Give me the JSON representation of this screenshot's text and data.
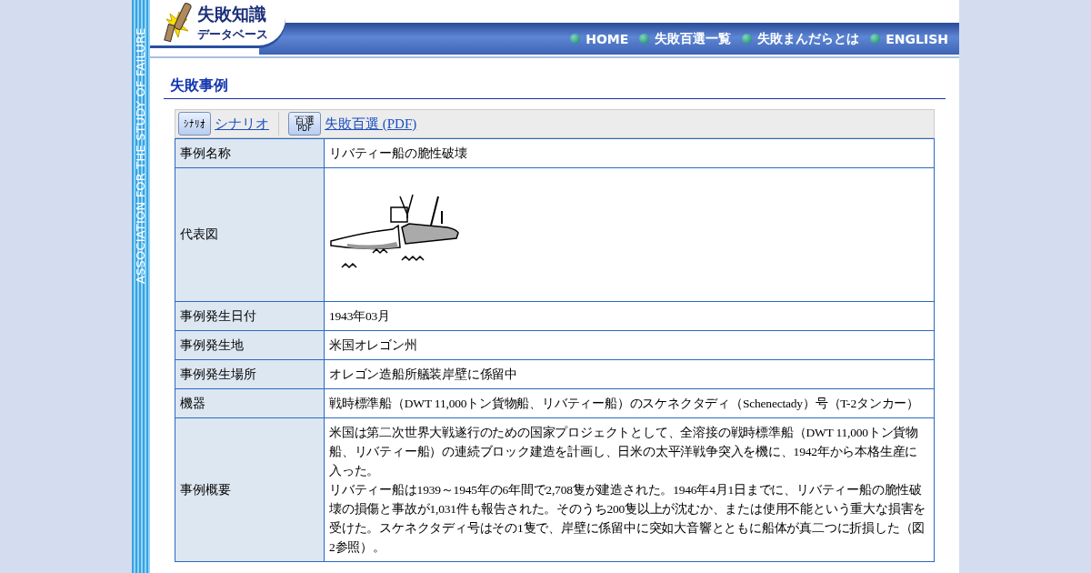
{
  "side_banner": {
    "text": "ASSOCIATION FOR THE STUDY OF FAILURE"
  },
  "logo": {
    "line_1": "失敗知識",
    "line_2": "データベース"
  },
  "nav": [
    {
      "label": "HOME"
    },
    {
      "label": "失敗百選一覧"
    },
    {
      "label": "失敗まんだらとは"
    },
    {
      "label": "ENGLISH"
    }
  ],
  "heading": "失敗事例",
  "toolbar": [
    {
      "badge": "ｼﾅﾘｵ",
      "label": "シナリオ"
    },
    {
      "badge": "百選",
      "sub": "PDF",
      "label": "失敗百選 (PDF)"
    }
  ],
  "rows": [
    {
      "kind": "text",
      "label": "事例名称",
      "value": [
        "リバティー船の脆性破壊"
      ]
    },
    {
      "kind": "figure",
      "label": "代表図"
    },
    {
      "kind": "text",
      "label": "事例発生日付",
      "value": [
        "1943年03月"
      ]
    },
    {
      "kind": "text",
      "label": "事例発生地",
      "value": [
        "米国オレゴン州"
      ]
    },
    {
      "kind": "text",
      "label": "事例発生場所",
      "value": [
        "オレゴン造船所艤装岸壁に係留中"
      ]
    },
    {
      "kind": "text",
      "label": "機器",
      "value": [
        "戦時標準船（DWT 11,000トン貨物船、リバティー船）のスケネクタディ（Schenectady）号（T-2タンカー）"
      ]
    },
    {
      "kind": "text",
      "label": "事例概要",
      "value": [
        "米国は第二次世界大戦遂行のための国家プロジェクトとして、全溶接の戦時標準船（DWT 11,000トン貨物船、リバティー船）の連続ブロック建造を計画し、日米の太平洋戦争突入を機に、1942年から本格生産に入った。",
        "リバティー船は1939～1945年の6年間で2,708隻が建造された。1946年4月1日までに、リバティー船の脆性破壊の損傷と事故が1,031件も報告された。そのうち200隻以上が沈むか、または使用不能という重大な損害を受けた。スケネクタディ号はその1隻で、岸壁に係留中に突如大音響とともに船体が真二つに折損した（図2参照）。"
      ]
    }
  ]
}
